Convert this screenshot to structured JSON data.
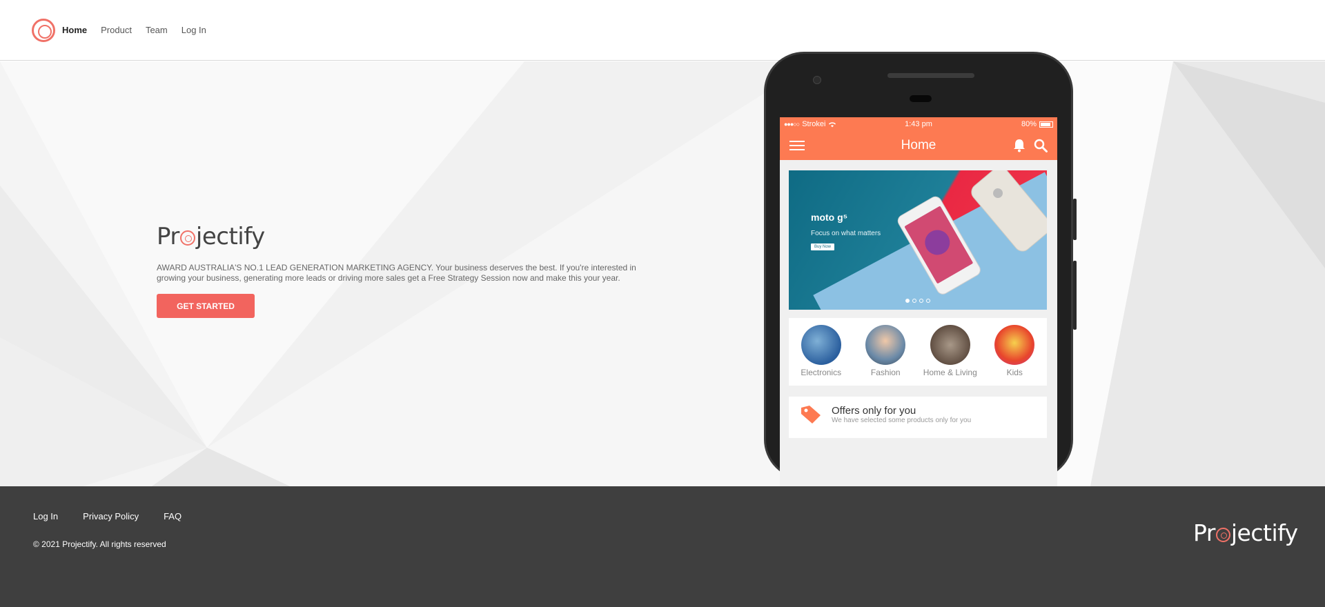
{
  "nav": {
    "links": [
      {
        "label": "Home",
        "active": true
      },
      {
        "label": "Product",
        "active": false
      },
      {
        "label": "Team",
        "active": false
      },
      {
        "label": "Log In",
        "active": false
      }
    ]
  },
  "hero": {
    "brand": {
      "part1": "Pr",
      "part2": "jectify"
    },
    "tagline": "AWARD AUSTRALIA'S NO.1 LEAD GENERATION MARKETING AGENCY. Your business deserves the best. If you're interested in growing your business, generating more leads or driving more sales get a Free Strategy Session now and make this your year.",
    "cta_label": "GET STARTED"
  },
  "phone": {
    "status": {
      "carrier": "Strokei",
      "time": "1:43 pm",
      "battery": "80%"
    },
    "appbar_title": "Home",
    "banner": {
      "brand": "moto g⁵",
      "tagline": "Focus on what matters",
      "button": "Buy Now"
    },
    "categories": [
      {
        "name": "Electronics",
        "color": "#2b5f9e"
      },
      {
        "name": "Fashion",
        "color": "#6b8aa8"
      },
      {
        "name": "Home & Living",
        "color": "#5c4a3e"
      },
      {
        "name": "Kids",
        "color": "#e8452c"
      }
    ],
    "offers": {
      "title": "Offers only for you",
      "subtitle": "We have selected some products only for you"
    }
  },
  "footer": {
    "links": [
      "Log In",
      "Privacy Policy",
      "FAQ"
    ],
    "copyright": "© 2021 Projectify. All rights reserved",
    "brand": {
      "part1": "Pr",
      "part2": "jectify"
    }
  },
  "colors": {
    "accent": "#f2645e",
    "app_orange": "#fd7a52",
    "footer_bg": "#3f3f3f"
  }
}
